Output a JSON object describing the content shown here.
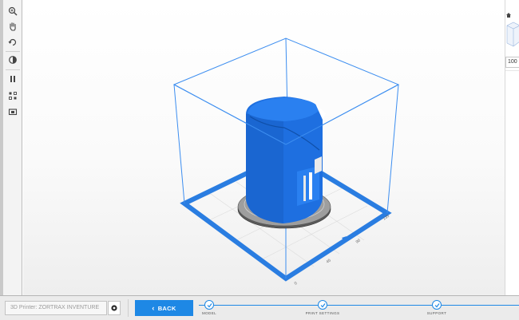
{
  "toolbar": {
    "tools": [
      {
        "name": "zoom-icon"
      },
      {
        "name": "pan-hand-icon"
      },
      {
        "name": "rotate-icon"
      },
      {
        "name": "view-cube-icon"
      },
      {
        "name": "layers-icon"
      },
      {
        "name": "arrange-icon"
      },
      {
        "name": "camera-icon"
      }
    ]
  },
  "viewport": {
    "axis_ticks": [
      "0",
      "45",
      "90",
      "135"
    ],
    "model_color": "#1e6fe0",
    "bounding_box_color": "#3d8ef0",
    "platform_color": "#2a7de1"
  },
  "right_panel": {
    "zoom_value": "100"
  },
  "bottom_bar": {
    "printer_field_value": "3D Printer: ZORTRAX INVENTURE",
    "back_button_label": "BACK",
    "steps": [
      {
        "label": "MODEL"
      },
      {
        "label": "PRINT SETTINGS"
      },
      {
        "label": "SUPPORT"
      }
    ],
    "accent_color": "#1e88e5"
  }
}
